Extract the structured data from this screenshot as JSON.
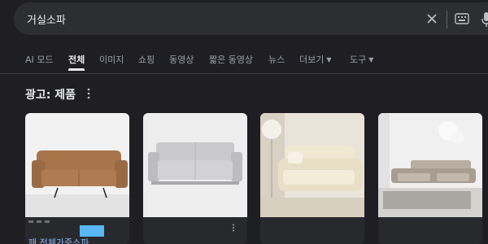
{
  "search": {
    "query": "거실소파"
  },
  "icons": {
    "clear": "close-icon",
    "keyboard": "keyboard-icon",
    "mic": "microphone-icon",
    "more": "more-vert-icon"
  },
  "tabs": [
    {
      "label": "AI 모드"
    },
    {
      "label": "전체"
    },
    {
      "label": "이미지"
    },
    {
      "label": "쇼핑"
    },
    {
      "label": "동영상"
    },
    {
      "label": "짧은 동영상"
    },
    {
      "label": "뉴스"
    },
    {
      "label": "더보기"
    },
    {
      "label": "도구"
    }
  ],
  "ads": {
    "heading": "광고: 제품",
    "products": [
      {
        "title": "패 전체가죽소파"
      },
      {
        "title": ""
      },
      {
        "title": ""
      },
      {
        "title": ""
      }
    ]
  },
  "colors": {
    "background": "#1f1f23",
    "search_bg": "#2d2e31",
    "link": "#8ab4f8",
    "text": "#e8eaed",
    "muted": "#9aa0a6"
  }
}
